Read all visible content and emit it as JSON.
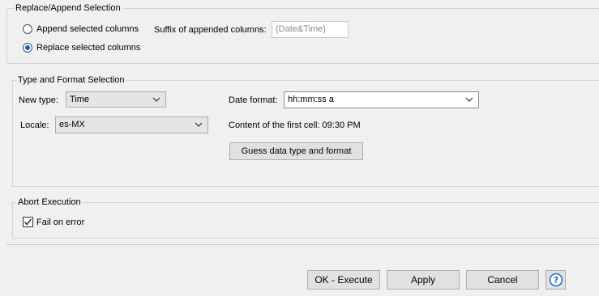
{
  "replace_append": {
    "legend": "Replace/Append Selection",
    "append_label": "Append selected columns",
    "replace_label": "Replace selected columns",
    "suffix_label": "Suffix of appended columns:",
    "suffix_value": "(Date&Time)",
    "selected": "replace"
  },
  "type_format": {
    "legend": "Type and Format Selection",
    "new_type_label": "New type:",
    "new_type_value": "Time",
    "locale_label": "Locale:",
    "locale_value": "es-MX",
    "date_format_label": "Date format:",
    "date_format_value": "hh:mm:ss a",
    "content_first_cell": "Content of the first cell: 09:30 PM",
    "guess_button": "Guess data type and format"
  },
  "abort": {
    "legend": "Abort Execution",
    "fail_on_error_label": "Fail on error",
    "fail_on_error_checked": true
  },
  "buttons": {
    "ok_execute": "OK - Execute",
    "apply": "Apply",
    "cancel": "Cancel"
  },
  "icons": {
    "chevron": "chevron-down-icon",
    "help": "help-icon",
    "check": "check-icon"
  },
  "colors": {
    "accent": "#0a63c8"
  }
}
